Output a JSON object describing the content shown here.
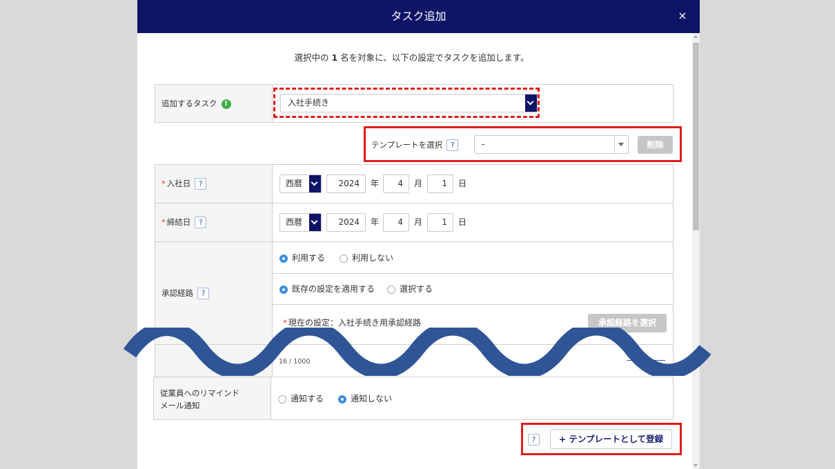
{
  "modal": {
    "title": "タスク追加",
    "close_glyph": "×"
  },
  "intro": {
    "prefix": "選択中の ",
    "count": "1",
    "suffix": " 名を対象に、以下の設定でタスクを追加します。"
  },
  "task_row": {
    "label": "追加するタスク",
    "info_glyph": "!",
    "selected": "入社手続き"
  },
  "template": {
    "label": "テンプレートを選択",
    "selected": "-",
    "delete_label": "削除"
  },
  "help_glyph": "?",
  "required_mark": "*",
  "join_date": {
    "label": "入社日",
    "era": "西暦",
    "year": "2024",
    "year_unit": "年",
    "month": "4",
    "month_unit": "月",
    "day": "1",
    "day_unit": "日"
  },
  "contract_date": {
    "label": "締結日",
    "era": "西暦",
    "year": "2024",
    "year_unit": "年",
    "month": "4",
    "month_unit": "月",
    "day": "1",
    "day_unit": "日"
  },
  "approval": {
    "label": "承認経路",
    "use_option": "利用する",
    "nouse_option": "利用しない",
    "use_selected": "利用する",
    "apply_option": "既存の設定を適用する",
    "choose_option": "選択する",
    "apply_selected": "既存の設定を適用する",
    "current_setting": "現在の設定：入社手続き用承認経路",
    "select_button": "承認経路を選択"
  },
  "partial_row": {
    "char_count": "16 / 1000"
  },
  "reminder": {
    "label_line1": "従業員へのリマインド",
    "label_line2": "メール通知",
    "notify_option": "通知する",
    "no_notify_option": "通知しない",
    "selected": "通知しない"
  },
  "footer": {
    "register_label": "テンプレートとして登録",
    "plus_glyph": "+"
  },
  "colors": {
    "header_bg": "#0e1466",
    "highlight_red": "#e01b1b",
    "wave_blue": "#2f5597",
    "radio_blue": "#3d8de0"
  }
}
